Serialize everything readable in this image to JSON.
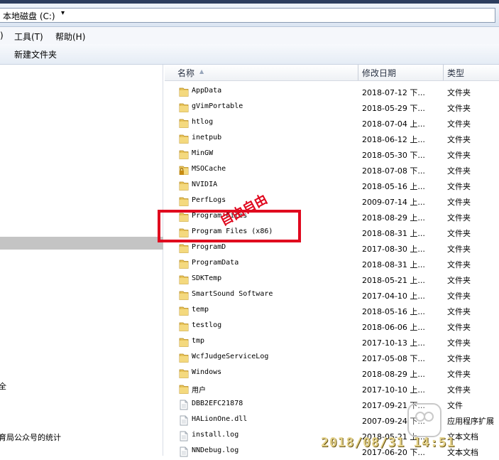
{
  "window": {
    "address": "本地磁盘 (C:)"
  },
  "menu": {
    "tools": "工具(T)",
    "help": "帮助(H)",
    "clipped": ")"
  },
  "toolbar": {
    "new_folder": "新建文件夹"
  },
  "columns": {
    "name": "名称",
    "date": "修改日期",
    "type": "类型"
  },
  "nav": {
    "item_a": "全",
    "item_b": "育局公众号的统计"
  },
  "files": [
    {
      "name": "AppData",
      "date": "2018-07-12 下...",
      "type": "文件夹",
      "icon": "folder-icon"
    },
    {
      "name": "gVimPortable",
      "date": "2018-05-29 下...",
      "type": "文件夹",
      "icon": "folder-icon"
    },
    {
      "name": "htlog",
      "date": "2018-07-04 上...",
      "type": "文件夹",
      "icon": "folder-icon"
    },
    {
      "name": "inetpub",
      "date": "2018-06-12 上...",
      "type": "文件夹",
      "icon": "folder-icon"
    },
    {
      "name": "MinGW",
      "date": "2018-05-30 下...",
      "type": "文件夹",
      "icon": "folder-icon"
    },
    {
      "name": "MSOCache",
      "date": "2018-07-08 下...",
      "type": "文件夹",
      "icon": "locked-folder-icon"
    },
    {
      "name": "NVIDIA",
      "date": "2018-05-16 上...",
      "type": "文件夹",
      "icon": "folder-icon"
    },
    {
      "name": "PerfLogs",
      "date": "2009-07-14 上...",
      "type": "文件夹",
      "icon": "folder-icon"
    },
    {
      "name": "Program Files",
      "date": "2018-08-29 上...",
      "type": "文件夹",
      "icon": "folder-icon"
    },
    {
      "name": "Program Files (x86)",
      "date": "2018-08-31 上...",
      "type": "文件夹",
      "icon": "folder-icon"
    },
    {
      "name": "ProgramD",
      "date": "2017-08-30 上...",
      "type": "文件夹",
      "icon": "folder-icon"
    },
    {
      "name": "ProgramData",
      "date": "2018-08-31 上...",
      "type": "文件夹",
      "icon": "folder-icon"
    },
    {
      "name": "SDKTemp",
      "date": "2018-05-21 上...",
      "type": "文件夹",
      "icon": "folder-icon"
    },
    {
      "name": "SmartSound Software",
      "date": "2017-04-10 上...",
      "type": "文件夹",
      "icon": "folder-icon"
    },
    {
      "name": "temp",
      "date": "2018-05-16 上...",
      "type": "文件夹",
      "icon": "folder-icon"
    },
    {
      "name": "testlog",
      "date": "2018-06-06 上...",
      "type": "文件夹",
      "icon": "folder-icon"
    },
    {
      "name": "tmp",
      "date": "2017-10-13 上...",
      "type": "文件夹",
      "icon": "folder-icon"
    },
    {
      "name": "WcfJudgeServiceLog",
      "date": "2017-05-08 下...",
      "type": "文件夹",
      "icon": "folder-icon"
    },
    {
      "name": "Windows",
      "date": "2018-08-29 上...",
      "type": "文件夹",
      "icon": "folder-icon"
    },
    {
      "name": "用户",
      "date": "2017-10-10 上...",
      "type": "文件夹",
      "icon": "folder-icon"
    },
    {
      "name": "DBB2EFC21878",
      "date": "2017-09-21 下...",
      "type": "文件",
      "icon": "file-icon"
    },
    {
      "name": "HALionOne.dll",
      "date": "2007-09-24 下...",
      "type": "应用程序扩展",
      "icon": "dll-file-icon"
    },
    {
      "name": "install.log",
      "date": "2018-05-21 上...",
      "type": "文本文档",
      "icon": "text-file-icon"
    },
    {
      "name": "NNDebug.log",
      "date": "2017-06-20 下...",
      "type": "文本文档",
      "icon": "text-file-icon"
    }
  ],
  "annotation": {
    "watermark": "自由自由",
    "stamp": "2018/08/31 14:51"
  },
  "colors": {
    "accent": "#e0081e",
    "folder": "#e7c35a",
    "selection": "#c4c4c4"
  }
}
